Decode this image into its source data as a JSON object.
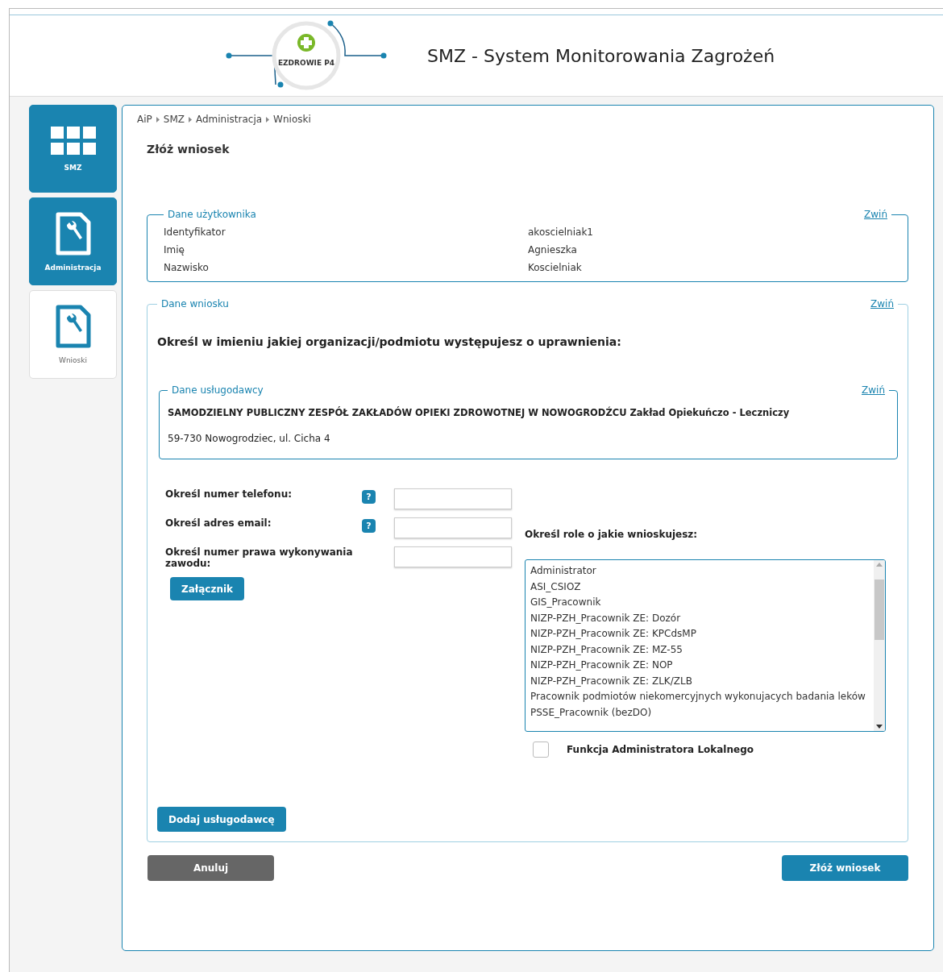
{
  "header": {
    "logo_text": "EZDROWIE P4",
    "title": "SMZ - System Monitorowania Zagrożeń"
  },
  "sidebar": {
    "items": [
      {
        "label": "SMZ",
        "kind": "grid",
        "selected": false
      },
      {
        "label": "Administracja",
        "kind": "document",
        "selected": false
      },
      {
        "label": "Wnioski",
        "kind": "document",
        "selected": true
      }
    ]
  },
  "breadcrumb": [
    "AiP",
    "SMZ",
    "Administracja",
    "Wnioski"
  ],
  "page_title": "Złóż wniosek",
  "user_section": {
    "legend": "Dane użytkownika",
    "collapse_link": "Zwiń",
    "fields": [
      {
        "label": "Identyfikator",
        "value": "akoscielniak1"
      },
      {
        "label": "Imię",
        "value": "Agnieszka"
      },
      {
        "label": "Nazwisko",
        "value": "Koscielniak"
      }
    ]
  },
  "request_section": {
    "legend": "Dane wniosku",
    "collapse_link": "Zwiń",
    "question": "Określ w imieniu jakiej organizacji/podmiotu występujesz o uprawnienia:",
    "provider": {
      "legend": "Dane usługodawcy",
      "collapse_link": "Zwiń",
      "name": "SAMODZIELNY PUBLICZNY ZESPÓŁ ZAKŁADÓW OPIEKI ZDROWOTNEJ W NOWOGRODŹCU Zakład Opiekuńczo - Leczniczy",
      "address": "59-730 Nowogrodziec, ul. Cicha 4"
    },
    "inputs": [
      {
        "label": "Określ numer telefonu:",
        "help": "?"
      },
      {
        "label": "Określ adres email:",
        "help": "?"
      },
      {
        "label": "Określ numer prawa wykonywania zawodu:"
      }
    ],
    "attachment_button": "Załącznik",
    "roles_label": "Określ role o jakie wnioskujesz:",
    "roles": [
      "Administrator",
      "ASI_CSIOZ",
      "GIS_Pracownik",
      "NIZP-PZH_Pracownik ZE: Dozór",
      "NIZP-PZH_Pracownik ZE: KPCdsMP",
      "NIZP-PZH_Pracownik ZE: MZ-55",
      "NIZP-PZH_Pracownik ZE: NOP",
      "NIZP-PZH_Pracownik ZE: ZLK/ZLB",
      "Pracownik podmiotów niekomercyjnych wykonujacych badania leków",
      "PSSE_Pracownik (bezDO)"
    ],
    "local_admin": {
      "label": "Funkcja Administratora Lokalnego",
      "checked": false
    },
    "add_provider_button": "Dodaj usługodawcę"
  },
  "buttons": [
    {
      "label": "Anuluj",
      "kind": "secondary"
    },
    {
      "label": "Złóż wniosek",
      "kind": "primary"
    }
  ]
}
